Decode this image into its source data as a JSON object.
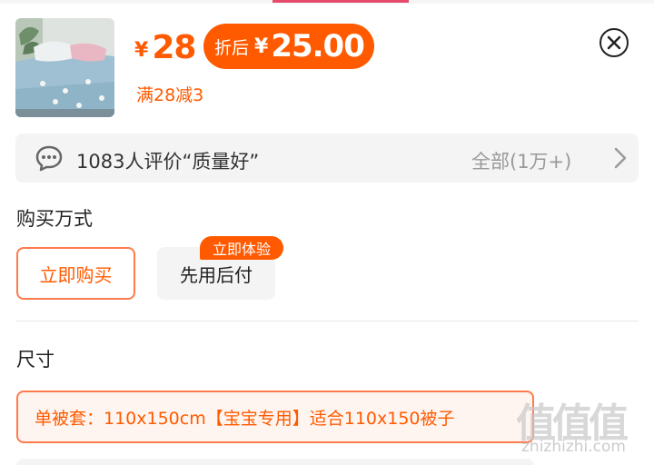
{
  "product": {
    "image_alt": "bedding-set-thumbnail",
    "currency_symbol": "¥",
    "price": "28",
    "discount_label": "折后",
    "discount_currency": "¥",
    "discount_price": "25.00",
    "promo_text": "满28减3"
  },
  "reviews": {
    "summary": "1083人评价“质量好”",
    "all_label": "全部(1万+)"
  },
  "purchase": {
    "title": "购买万式",
    "options": [
      "立即购买",
      "先用后付"
    ],
    "badge": "立即体验",
    "selected": "立即购买"
  },
  "size": {
    "title": "尺寸",
    "options": [
      "单被套：110x150cm【宝宝专用】适合110x150被子"
    ],
    "selected": "单被套：110x150cm【宝宝专用】适合110x150被子"
  },
  "watermark": {
    "glyphs": "值值值",
    "site": "zhizhizhi.com"
  },
  "colors": {
    "accent": "#ff5a00",
    "border_accent": "#ff7a4d",
    "top_bar_accent": "#e64a6b",
    "panel_bg": "#f4f4f4"
  },
  "icons": [
    "close-icon",
    "chat-bubble-icon",
    "chevron-right-icon"
  ]
}
